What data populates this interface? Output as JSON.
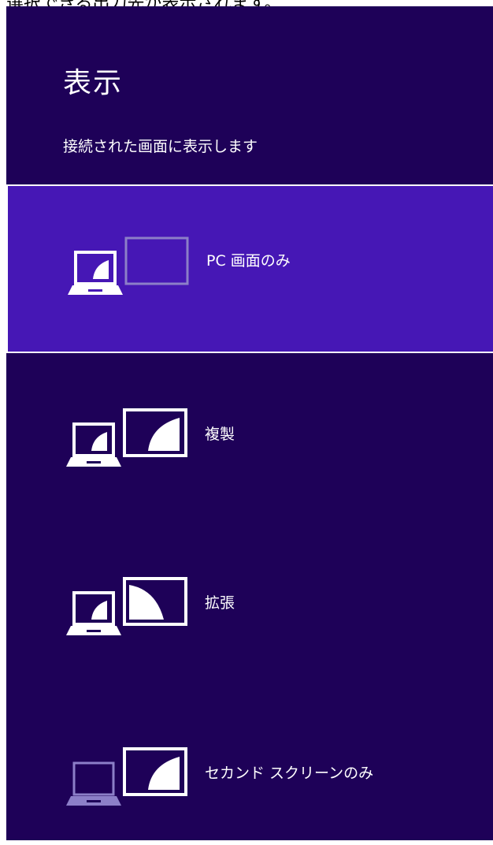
{
  "caption": "選択できる出力先が表示されます。",
  "panel": {
    "title": "表示",
    "subtitle": "接続された画面に表示します",
    "options": [
      {
        "label": "PC 画面のみ",
        "selected": true
      },
      {
        "label": "複製",
        "selected": false
      },
      {
        "label": "拡張",
        "selected": false
      },
      {
        "label": "セカンド スクリーンのみ",
        "selected": false
      }
    ]
  },
  "colors": {
    "background": "#1e0158",
    "selected": "#4617b5",
    "text": "#ffffff",
    "dimmed_icon": "#8c7fc8"
  },
  "icons": [
    "pc-screen-only-icon",
    "duplicate-icon",
    "extend-icon",
    "second-screen-only-icon"
  ]
}
